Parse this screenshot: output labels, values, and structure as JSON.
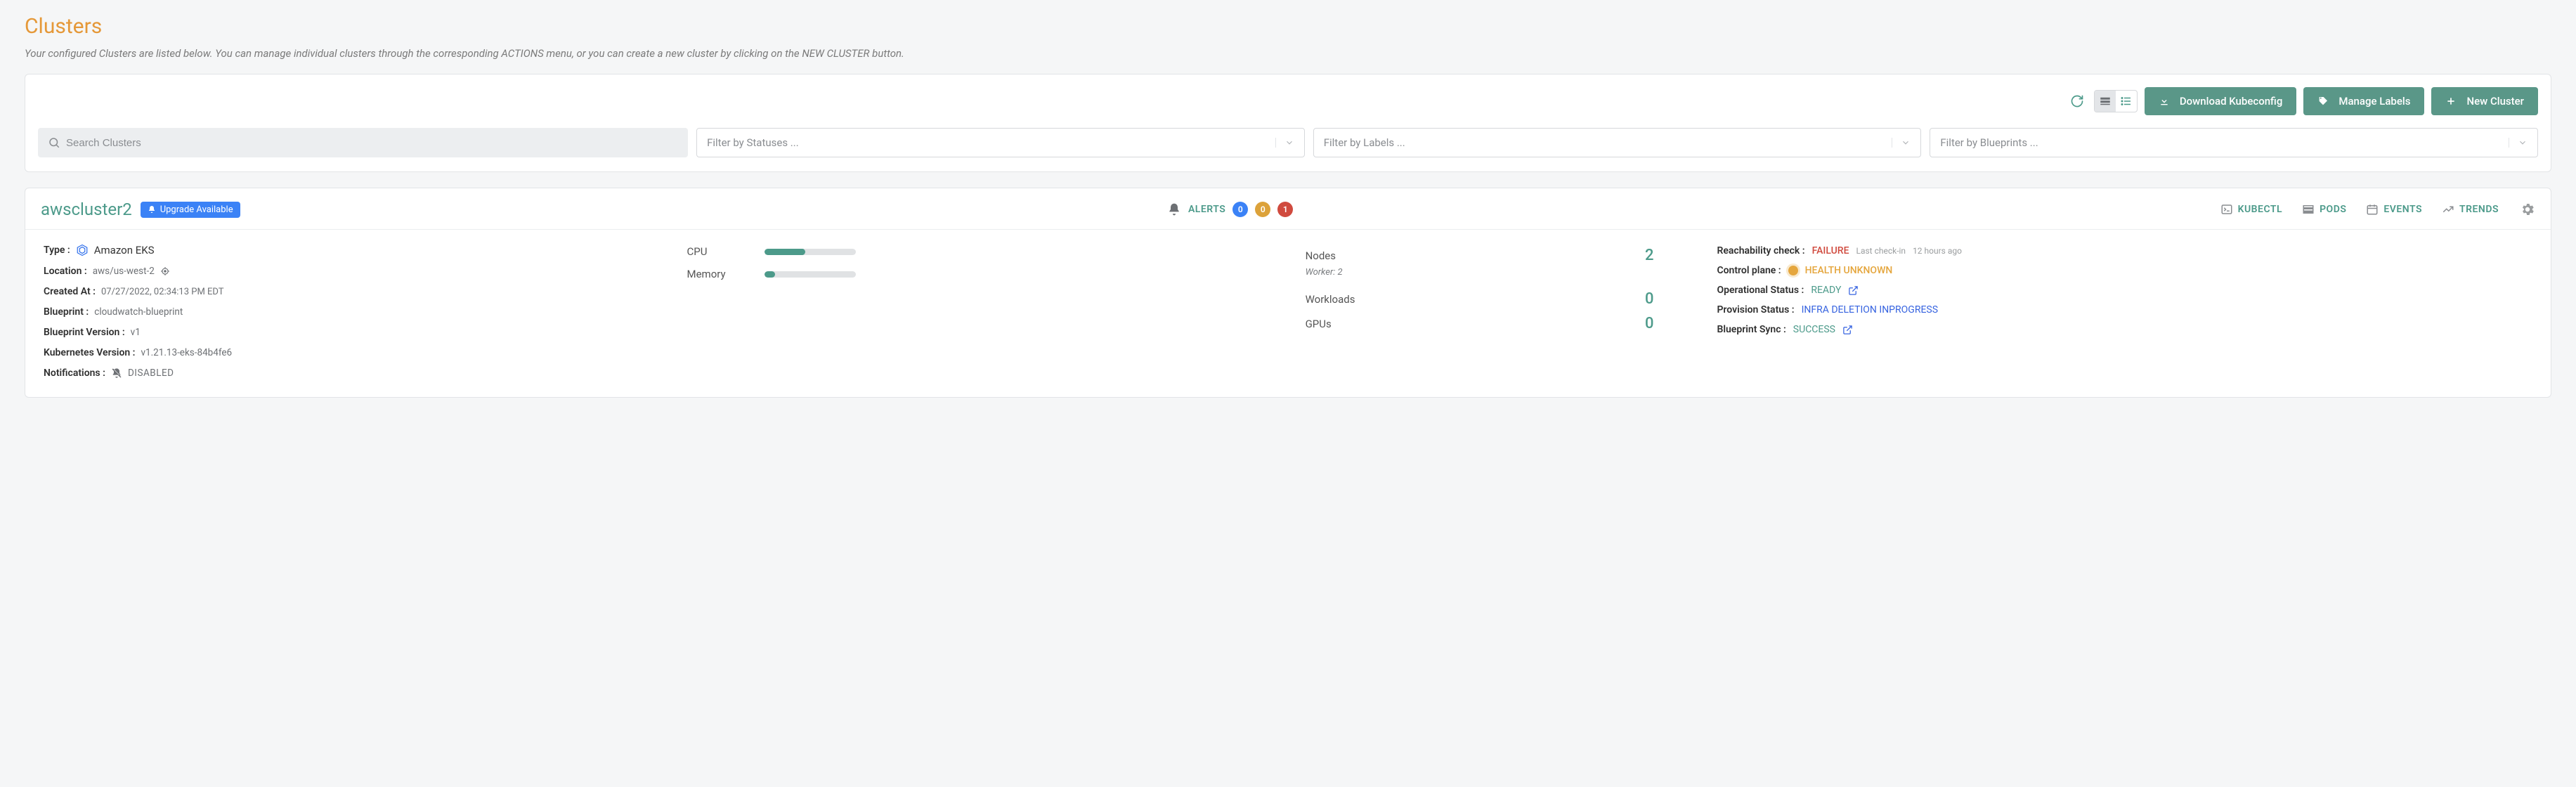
{
  "page": {
    "title": "Clusters",
    "subtitle": "Your configured Clusters are listed below. You can manage individual clusters through the corresponding ACTIONS menu, or you can create a new cluster by clicking on the NEW CLUSTER button."
  },
  "toolbar": {
    "download_label": "Download Kubeconfig",
    "labels_label": "Manage Labels",
    "new_cluster_label": "New Cluster"
  },
  "filters": {
    "search_placeholder": "Search Clusters",
    "status_placeholder": "Filter by Statuses ...",
    "labels_placeholder": "Filter by Labels ...",
    "blueprints_placeholder": "Filter by Blueprints ..."
  },
  "cluster": {
    "name": "awscluster2",
    "upgrade_badge": "Upgrade Available",
    "alerts_label": "ALERTS",
    "alerts": {
      "info": "0",
      "warn": "0",
      "crit": "1"
    },
    "links": {
      "kubectl": "KUBECTL",
      "pods": "PODS",
      "events": "EVENTS",
      "trends": "TRENDS"
    },
    "meta": {
      "type_k": "Type :",
      "type_v": "Amazon EKS",
      "location_k": "Location :",
      "location_v": "aws/us-west-2",
      "created_k": "Created At :",
      "created_v": "07/27/2022, 02:34:13 PM EDT",
      "blueprint_k": "Blueprint :",
      "blueprint_v": "cloudwatch-blueprint",
      "bpver_k": "Blueprint Version :",
      "bpver_v": "v1",
      "k8s_k": "Kubernetes Version :",
      "k8s_v": "v1.21.13-eks-84b4fe6",
      "notif_k": "Notifications :",
      "notif_v": "DISABLED"
    },
    "meters": {
      "cpu_label": "CPU",
      "cpu_pct": 45,
      "mem_label": "Memory",
      "mem_pct": 12
    },
    "stats": {
      "nodes_label": "Nodes",
      "nodes_val": "2",
      "nodes_sub": "Worker: 2",
      "workloads_label": "Workloads",
      "workloads_val": "0",
      "gpus_label": "GPUs",
      "gpus_val": "0"
    },
    "status": {
      "reach_k": "Reachability check :",
      "reach_v": "FAILURE",
      "reach_sub_k": "Last check-in",
      "reach_sub_v": "12 hours ago",
      "cp_k": "Control plane :",
      "cp_v": "HEALTH UNKNOWN",
      "op_k": "Operational Status :",
      "op_v": "READY",
      "prov_k": "Provision Status :",
      "prov_v": "INFRA DELETION INPROGRESS",
      "sync_k": "Blueprint Sync :",
      "sync_v": "SUCCESS"
    }
  }
}
